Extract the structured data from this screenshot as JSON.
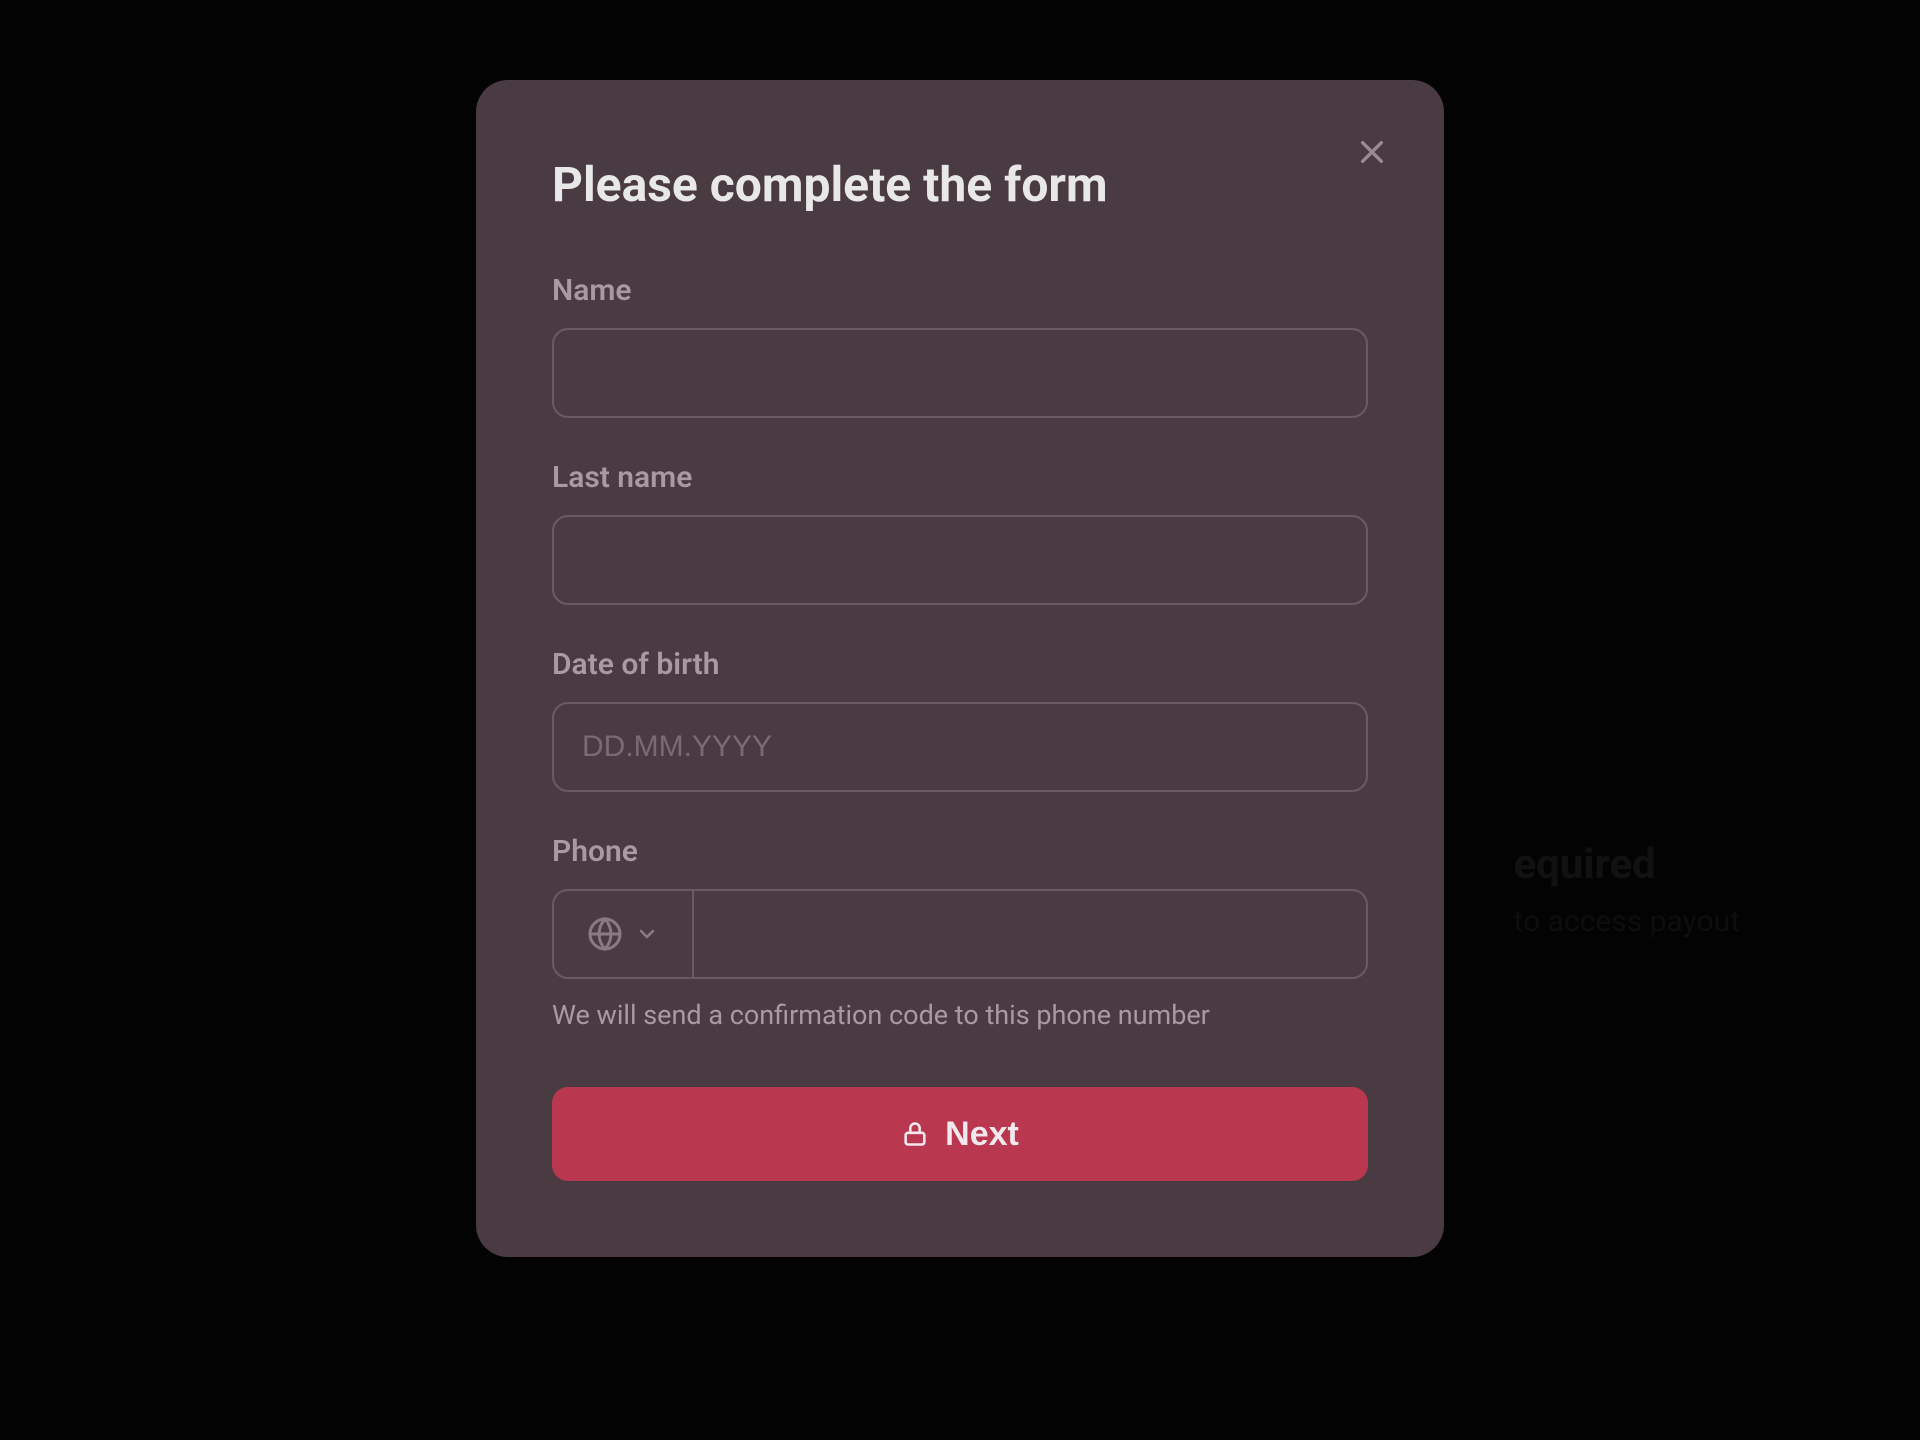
{
  "background": {
    "heading_fragment": "equired",
    "sub_fragment": "to access payout"
  },
  "modal": {
    "title": "Please complete the form",
    "fields": {
      "name": {
        "label": "Name",
        "value": ""
      },
      "lastname": {
        "label": "Last name",
        "value": ""
      },
      "dob": {
        "label": "Date of birth",
        "placeholder": "DD.MM.YYYY",
        "value": ""
      },
      "phone": {
        "label": "Phone",
        "value": "",
        "helper": "We will send a confirmation code to this phone number"
      }
    },
    "submit_label": "Next"
  },
  "icons": {
    "close": "close-icon",
    "globe": "globe-icon",
    "chevron_down": "chevron-down-icon",
    "lock": "lock-icon"
  }
}
